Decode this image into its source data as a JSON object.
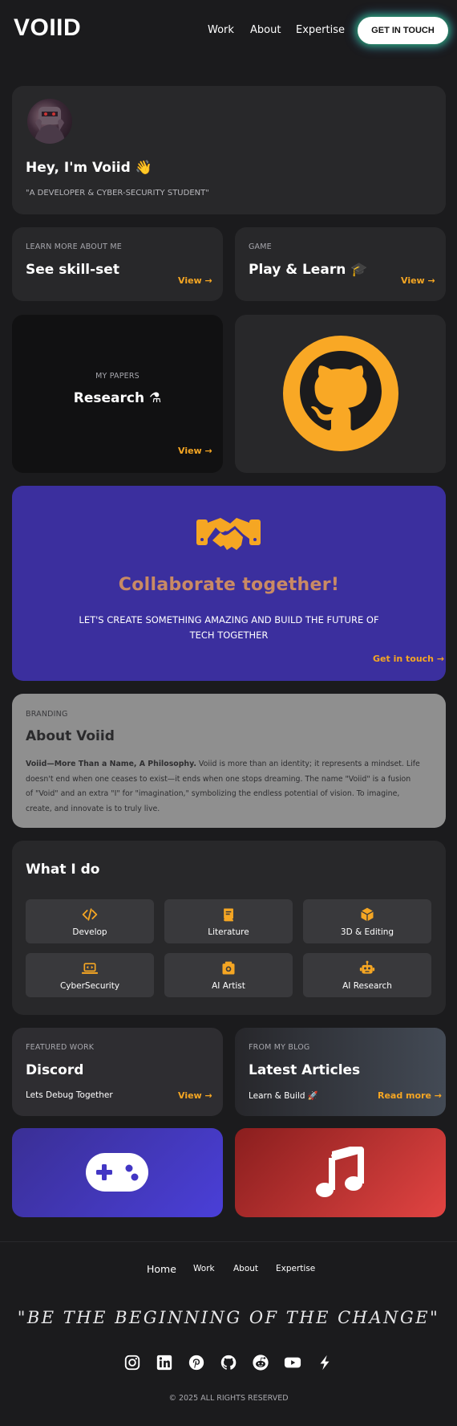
{
  "header": {
    "logo": "VOIID",
    "nav": [
      "Work",
      "About",
      "Expertise"
    ],
    "cta": "GET IN TOUCH"
  },
  "intro": {
    "greeting": "Hey, I'm Voiid 👋",
    "tagline": "\"A DEVELOPER & CYBER-SECURITY STUDENT\""
  },
  "skills_card": {
    "eyebrow": "LEARN MORE ABOUT ME",
    "title": "See skill-set",
    "link": "View →"
  },
  "game_card": {
    "eyebrow": "GAME",
    "title": "Play & Learn 🎓",
    "link": "View →"
  },
  "papers_card": {
    "eyebrow": "MY PAPERS",
    "title": "Research ⚗",
    "link": "View →"
  },
  "github_card": {
    "icon": "github-icon",
    "color": "#f9a825"
  },
  "collab": {
    "icon": "handshake-icon",
    "title": "Collaborate together!",
    "line1": "LET'S CREATE SOMETHING AMAZING AND BUILD THE FUTURE OF",
    "line2": "TECH TOGETHER",
    "link": "Get in touch →",
    "bg": "#3b2f9e"
  },
  "about": {
    "eyebrow": "BRANDING",
    "title": "About Voiid",
    "lead": "Voiid—More Than a Name, A Philosophy.",
    "l1": " Voiid is more than an identity; it represents a mindset. Life",
    "l2": "doesn't end when one ceases to exist—it ends when one stops dreaming. The name \"Voiid\" is a fusion",
    "l3": "of \"Void\" and an extra \"I\" for \"imagination,\" symbolizing the endless potential of vision. To imagine,",
    "l4": "create, and innovate is to truly live."
  },
  "what_i_do": {
    "title": "What I do",
    "items": [
      {
        "label": "Develop",
        "icon": "code-icon"
      },
      {
        "label": "Literature",
        "icon": "book-icon"
      },
      {
        "label": "3D & Editing",
        "icon": "cube-icon"
      },
      {
        "label": "CyberSecurity",
        "icon": "laptop-code-icon"
      },
      {
        "label": "AI Artist",
        "icon": "camera-icon"
      },
      {
        "label": "AI Research",
        "icon": "robot-icon"
      }
    ]
  },
  "featured": {
    "eyebrow": "FEATURED WORK",
    "title": "Discord",
    "sub": "Lets Debug Together",
    "link": "View →"
  },
  "blog": {
    "eyebrow": "FROM MY BLOG",
    "title": "Latest Articles",
    "sub": "Learn & Build 🚀",
    "link": "Read more →"
  },
  "tiles": [
    {
      "icon": "gamepad-icon",
      "bg": "#4a3fd8"
    },
    {
      "icon": "music-icon",
      "bg": "#d13a37"
    }
  ],
  "footer": {
    "nav": [
      "Home",
      "Work",
      "About",
      "Expertise"
    ],
    "quote": "\"BE THE BEGINNING OF THE CHANGE\"",
    "socials": [
      "instagram-icon",
      "linkedin-icon",
      "pinterest-icon",
      "github-icon",
      "reddit-icon",
      "youtube-icon",
      "bolt-icon"
    ],
    "copyright": "© 2025 ALL RIGHTS RESERVED"
  },
  "colors": {
    "accent": "#f5a623",
    "bg": "#1b1b1d",
    "card": "#28282a"
  }
}
